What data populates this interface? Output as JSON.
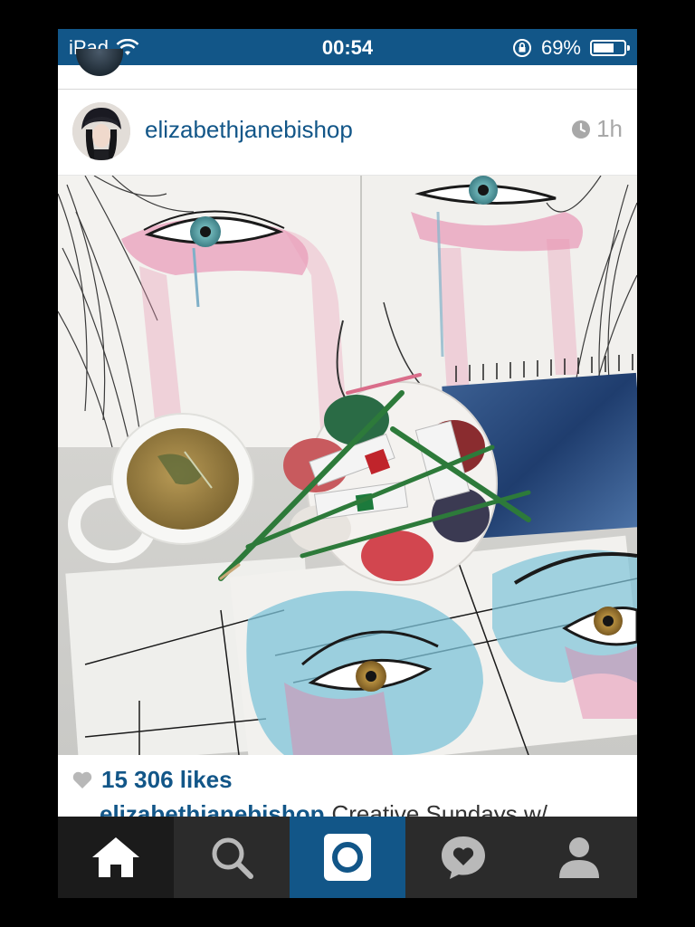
{
  "status_bar": {
    "device": "iPad",
    "time": "00:54",
    "battery": "69%",
    "battery_level": 0.69
  },
  "post": {
    "username": "elizabethjanebishop",
    "timestamp": "1h",
    "likes": "15 306 likes",
    "caption_user": "elizabethjanebishop",
    "caption_text": "Creative Sundays w/"
  },
  "tab_bar": {
    "tabs": [
      "home-icon",
      "search-icon",
      "camera-icon",
      "activity-icon",
      "profile-icon"
    ],
    "active": "camera-icon"
  },
  "colors": {
    "brand_blue": "#125688",
    "tab_bar_bg": "#2b2b2b",
    "tab_home_bg": "#1b1b1b",
    "muted_gray": "#a8a8a8"
  }
}
